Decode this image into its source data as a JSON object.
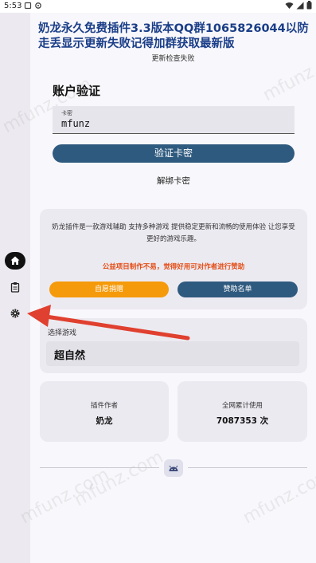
{
  "status_bar": {
    "time": "5:53"
  },
  "header": {
    "title": "奶龙永久免费插件3.3版本QQ群1065826044以防走丢显示更新失败记得加群获取最新版",
    "subtitle": "更新检查失败"
  },
  "auth": {
    "heading": "账户验证",
    "field_label": "卡密",
    "field_value": "mfunz",
    "verify_button": "验证卡密",
    "unbind_link": "解绑卡密"
  },
  "info": {
    "description": "奶龙插件是一款游戏辅助 支持多种游戏 提供稳定更新和流畅的使用体验 让您享受更好的游戏乐趣。",
    "notice": "公益项目制作不易，觉得好用可对作者进行赞助",
    "donate_button": "自愿捐赠",
    "sponsors_button": "赞助名单"
  },
  "game": {
    "label": "选择游戏",
    "selected": "超自然"
  },
  "stats": {
    "author_label": "插件作者",
    "author_value": "奶龙",
    "usage_label": "全网累计使用",
    "usage_value": "7087353 次"
  },
  "watermark": "mfunz.com",
  "icons": {
    "nav_home": "home-icon",
    "nav_clipboard": "clipboard-icon",
    "nav_settings": "gear-icon",
    "footer": "android-icon"
  },
  "colors": {
    "primary": "#2f5a7f",
    "title": "#1a3e88",
    "donate": "#f59a0b",
    "notice": "#e44d16",
    "annotation_arrow": "#e0402f"
  }
}
